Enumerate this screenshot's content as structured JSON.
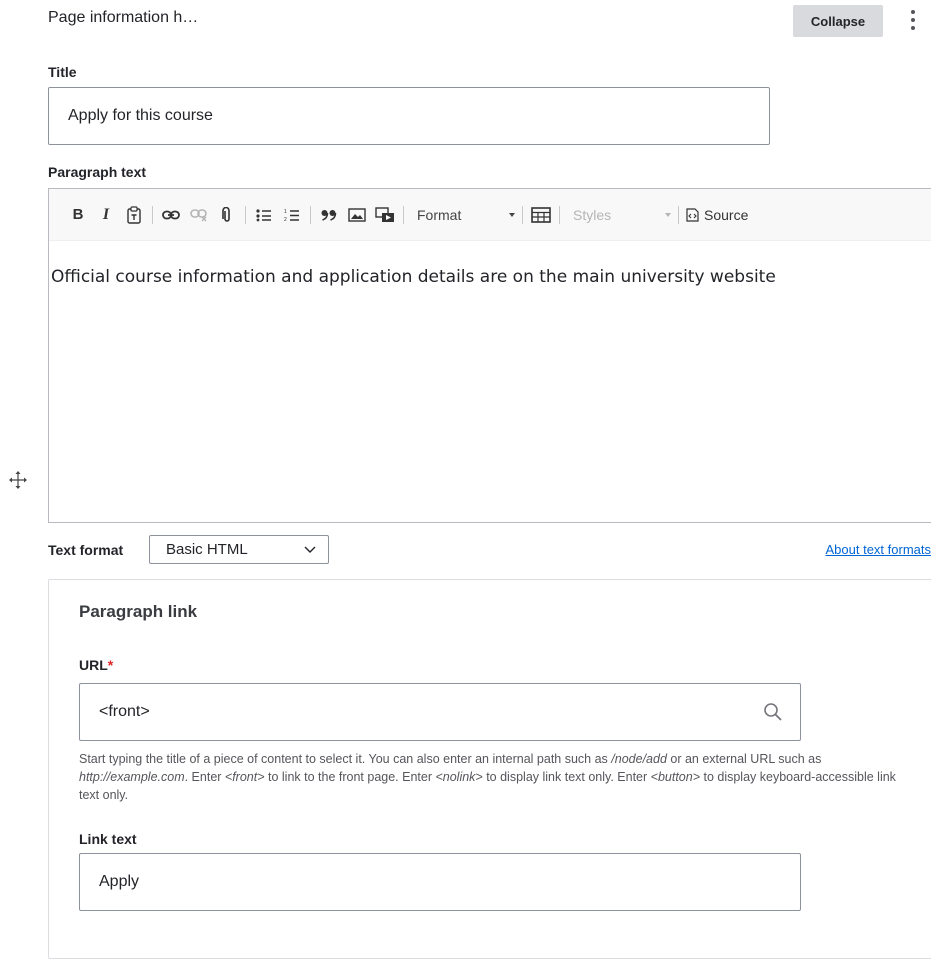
{
  "header": {
    "title": "Page information h…",
    "collapse_label": "Collapse"
  },
  "fields": {
    "title": {
      "label": "Title",
      "value": "Apply for this course"
    },
    "paragraph_text": {
      "label": "Paragraph text",
      "content": "Official course information and application details are on the main university website"
    }
  },
  "toolbar": {
    "bold": "B",
    "italic": "I",
    "format_label": "Format",
    "styles_label": "Styles",
    "source_label": "Source"
  },
  "text_format": {
    "label": "Text format",
    "selected": "Basic HTML",
    "about_link": "About text formats"
  },
  "paragraph_link": {
    "title": "Paragraph link",
    "url": {
      "label": "URL",
      "required_mark": "*",
      "value": "<front>",
      "help": {
        "p1": "Start typing the title of a piece of content to select it. You can also enter an internal path such as ",
        "e1": "/node/add",
        "p2": " or an external URL such as ",
        "e2": "http://example.com",
        "p3": ". Enter ",
        "e3": "<front>",
        "p4": " to link to the front page. Enter ",
        "e4": "<nolink>",
        "p5": " to display link text only. Enter ",
        "e5": "<button>",
        "p6": " to display keyboard-accessible link text only."
      }
    },
    "link_text": {
      "label": "Link text",
      "value": "Apply"
    }
  },
  "icons": [
    "paste-text-icon",
    "link-icon",
    "unlink-icon",
    "attachment-icon",
    "bulleted-list-icon",
    "numbered-list-icon",
    "blockquote-icon",
    "image-icon",
    "media-icon",
    "table-icon",
    "source-icon",
    "drag-handle-icon",
    "search-icon",
    "chevron-down-icon",
    "kebab-menu-icon"
  ],
  "colors": {
    "link": "#0065d5",
    "required": "#dc2323",
    "collapse_bg": "#d8dade"
  }
}
